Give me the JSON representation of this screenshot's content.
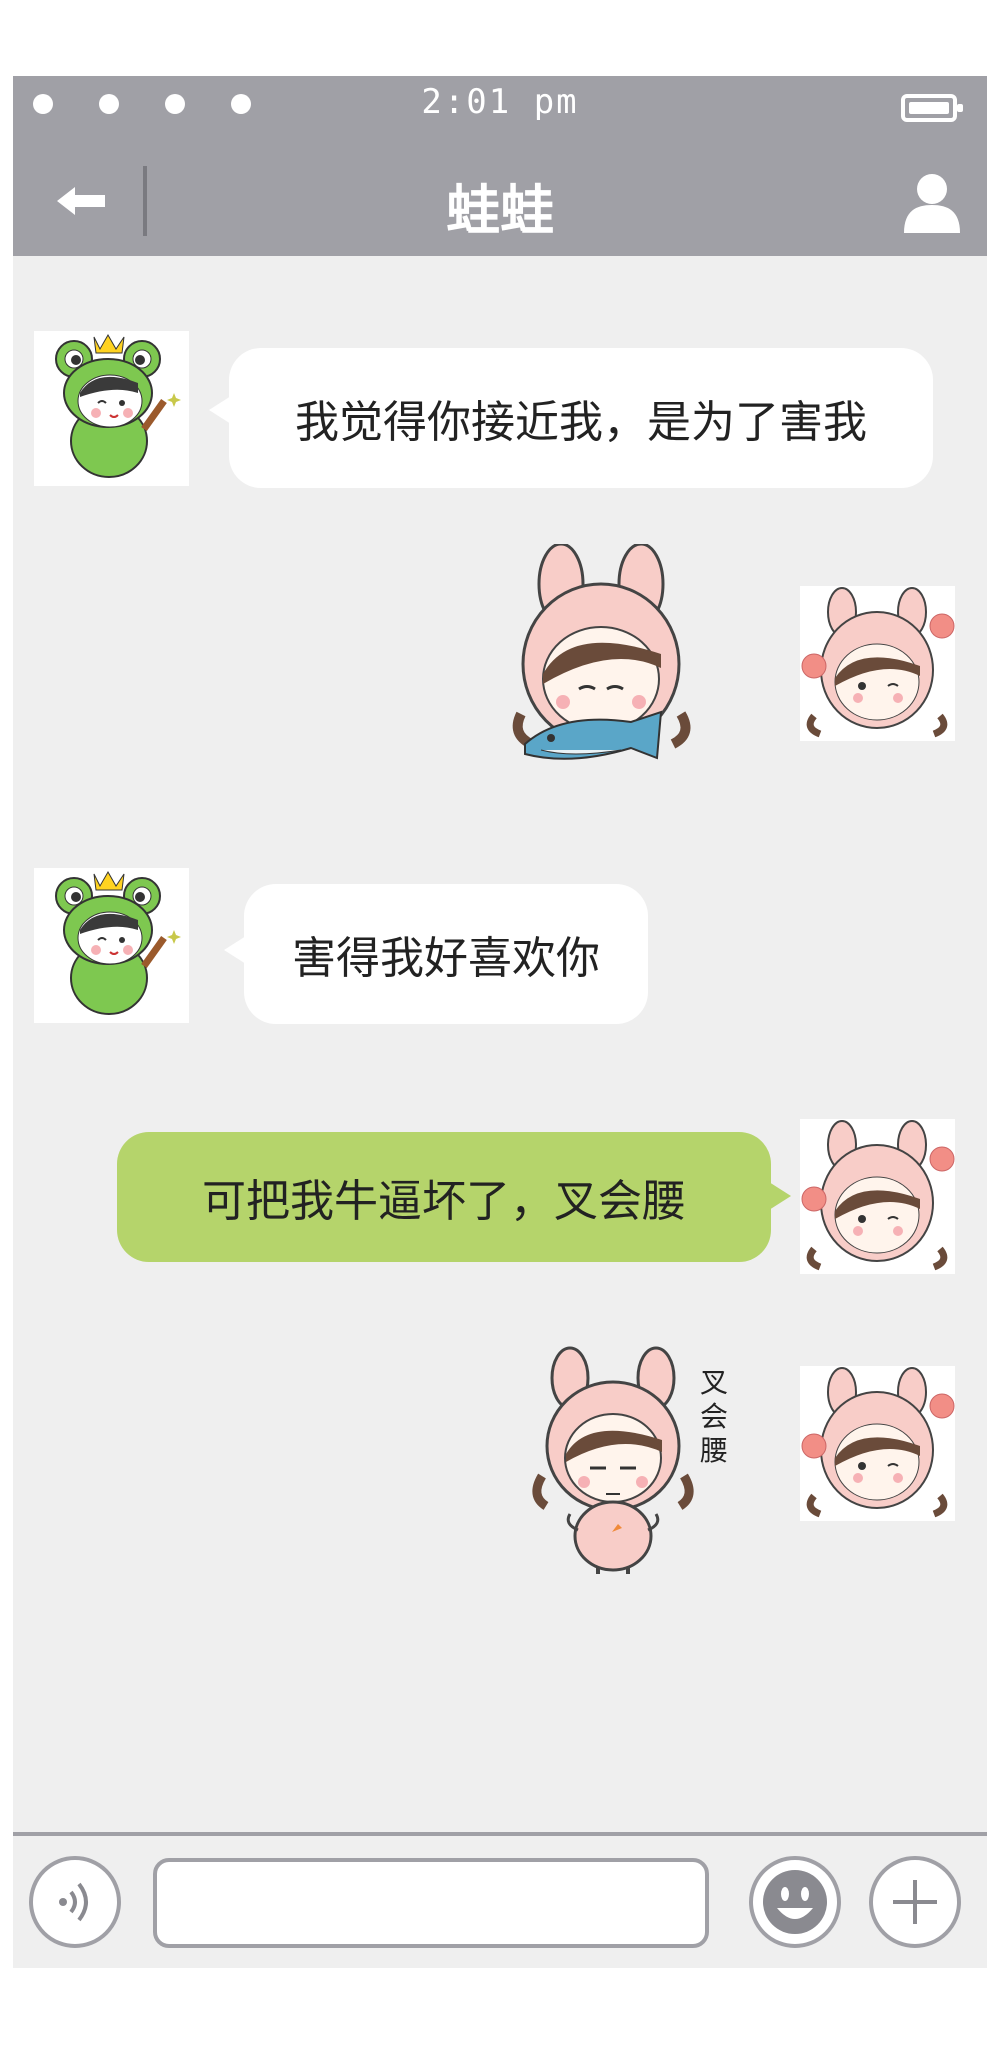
{
  "status": {
    "time": "2:01 pm"
  },
  "header": {
    "title": "蛙蛙"
  },
  "messages": [
    {
      "side": "left",
      "type": "text",
      "text": "我觉得你接近我，是为了害我"
    },
    {
      "side": "right",
      "type": "sticker",
      "sticker": "bunny-girl-holding-fish"
    },
    {
      "side": "left",
      "type": "text",
      "text": "害得我好喜欢你"
    },
    {
      "side": "right",
      "type": "text",
      "text": "可把我牛逼坏了，叉会腰"
    },
    {
      "side": "right",
      "type": "sticker",
      "sticker": "bunny-girl-hands-on-hips",
      "caption": [
        "叉",
        "会",
        "腰"
      ]
    }
  ],
  "composer": {
    "placeholder": ""
  },
  "colors": {
    "header": "#a0a0a6",
    "background": "#efefef",
    "my_bubble": "#b5d46b",
    "their_bubble": "#ffffff"
  },
  "icons": {
    "back": "arrow-left-icon",
    "contact": "user-icon",
    "voice": "voice-icon",
    "emoji": "emoji-icon",
    "more": "plus-icon"
  }
}
